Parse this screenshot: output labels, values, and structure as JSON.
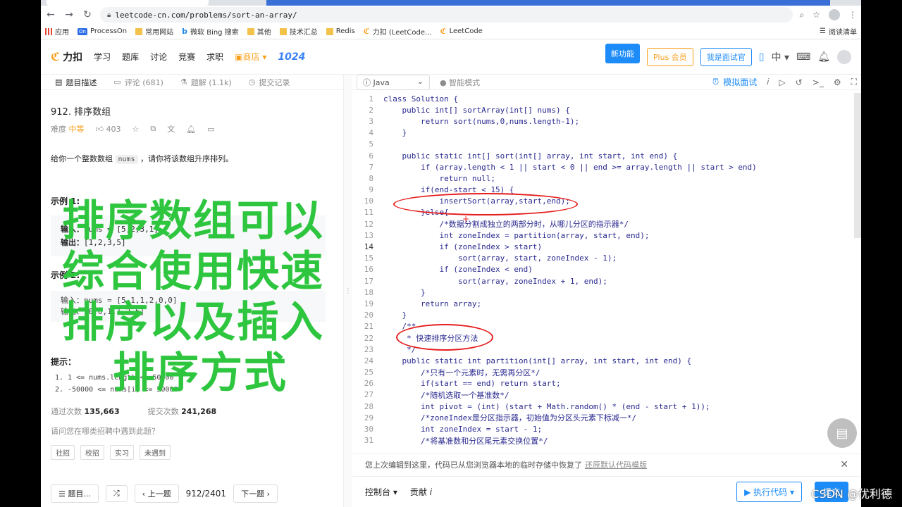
{
  "browser": {
    "url": "leetcode-cn.com/problems/sort-an-array/",
    "bookmarks": [
      "应用",
      "ProcessOn",
      "常用网站",
      "微软 Bing 搜索",
      "其他",
      "技术汇总",
      "Redis",
      "力扣 (LeetCode...",
      "LeetCode"
    ],
    "reading_list": "阅读清单"
  },
  "nav": {
    "logo": "力扣",
    "items": [
      "学习",
      "题库",
      "讨论",
      "竞赛",
      "求职"
    ],
    "shop": "商店",
    "brand": "1024",
    "new_feature": "新功能",
    "plus": "Plus 会员",
    "interviewer": "我是面试官",
    "language": "中"
  },
  "left": {
    "tabs": [
      "题目描述",
      "评论 (681)",
      "题解 (1.1k)",
      "提交记录"
    ],
    "title": "912. 排序数组",
    "difficulty_label": "难度",
    "difficulty": "中等",
    "likes": "403",
    "desc_prefix": "给你一个整数数组",
    "desc_code": "nums",
    "desc_suffix": "，请你将该数组升序排列。",
    "ex1_title": "示例 1:",
    "ex1_in_label": "输入：",
    "ex1_in": "nums = [5,2,3,1]",
    "ex1_out_label": "输出：",
    "ex1_out": "[1,2,3,5]",
    "ex2_title": "示例 2:",
    "ex2_in": "输入：nums = [5,1,1,2,0,0]",
    "ex2_out": "输出：[0,0,1,1,2,5]",
    "hint_title": "提示：",
    "hints": [
      "1 <= nums.length <= 50000",
      "-50000 <= nums[i] <= 50000"
    ],
    "pass_label": "通过次数",
    "pass_count": "135,663",
    "submit_label": "提交次数",
    "submit_count": "241,268",
    "ask": "请问您在哪类招聘中遇到此题？",
    "tags": [
      "社招",
      "校招",
      "实习",
      "未遇到"
    ],
    "footer_list": "题目...",
    "footer_prev": "上一题",
    "footer_page": "912/2401",
    "footer_next": "下一题"
  },
  "overlay_text": [
    "排序数组可以",
    "综合使用快速",
    "排序以及插入",
    "排序方式"
  ],
  "editor": {
    "language": "Java",
    "smart_mode": "智能模式",
    "mock": "模拟面试",
    "lines": [
      "class Solution {",
      "    public int[] sortArray(int[] nums) {",
      "        return sort(nums,0,nums.length-1);",
      "    }",
      "",
      "    public static int[] sort(int[] array, int start, int end) {",
      "        if (array.length < 1 || start < 0 || end >= array.length || start > end)",
      "            return null;",
      "        if(end-start < 15) {",
      "            insertSort(array,start,end);",
      "        }else{",
      "            /*数据分割成独立的两部分时，从哪儿分区的指示器*/",
      "            int zoneIndex = partition(array, start, end);",
      "            if (zoneIndex > start)",
      "                sort(array, start, zoneIndex - 1);",
      "            if (zoneIndex < end)",
      "                sort(array, zoneIndex + 1, end);",
      "        }",
      "        return array;",
      "    }",
      "    /**",
      "     * 快速排序分区方法",
      "     */",
      "    public static int partition(int[] array, int start, int end) {",
      "        /*只有一个元素时，无需再分区*/",
      "        if(start == end) return start;",
      "        /*随机选取一个基准数*/",
      "        int pivot = (int) (start + Math.random() * (end - start + 1));",
      "        /*zoneIndex是分区指示器，初始值为分区头元素下标减一*/",
      "        int zoneIndex = start - 1;",
      "        /*将基准数和分区尾元素交换位置*/"
    ],
    "restore_msg": "您上次编辑到这里，代码已从您浏览器本地的临时存储中恢复了",
    "restore_link": "还原默认代码模版",
    "console": "控制台",
    "contribute": "贡献",
    "run": "执行代码",
    "submit": "提交"
  },
  "watermark": "CSDN @优利德"
}
